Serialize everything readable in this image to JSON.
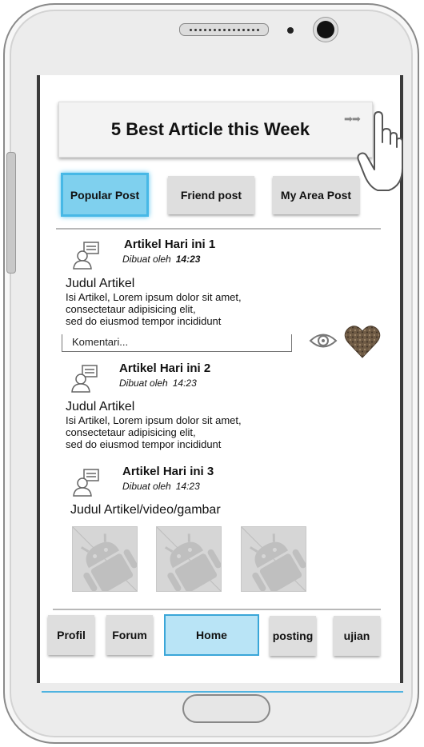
{
  "banner": {
    "title": "5 Best Article this Week",
    "arrow_icons": "➡➡"
  },
  "tabs": [
    {
      "label": "Popular Post",
      "active": true
    },
    {
      "label": "Friend post",
      "active": false
    },
    {
      "label": "My Area Post",
      "active": false
    }
  ],
  "posts": [
    {
      "title": "Artikel Hari ini 1",
      "meta_by": "Dibuat oleh",
      "meta_time": "14:23",
      "heading": "Judul Artikel",
      "body": [
        "Isi Artikel, Lorem ipsum dolor sit amet,",
        "consectetaur adipisicing elit,",
        "sed do eiusmod tempor incididunt"
      ],
      "comment_placeholder": "Komentari..."
    },
    {
      "title": "Artikel Hari ini 2",
      "meta_by": "Dibuat oleh",
      "meta_time": "14:23",
      "heading": "Judul Artikel",
      "body": [
        "Isi Artikel, Lorem ipsum dolor sit amet,",
        "consectetaur adipisicing elit,",
        "sed do eiusmod tempor incididunt"
      ]
    },
    {
      "title": "Artikel Hari ini 3",
      "meta_by": "Dibuat oleh",
      "meta_time": "14:23",
      "heading": "Judul Artikel/video/gambar",
      "media_count": 3
    }
  ],
  "bottom_nav": [
    {
      "label": "Profil",
      "active": false
    },
    {
      "label": "Forum",
      "active": false
    },
    {
      "label": "Home",
      "active": true
    },
    {
      "label": "posting",
      "active": false
    },
    {
      "label": "ujian",
      "active": false
    }
  ],
  "icons": {
    "post_author": "user-post-icon",
    "view": "eye-icon",
    "like": "heart-icon",
    "pointer": "hand-pointer-icon",
    "media": "android-placeholder-icon"
  },
  "colors": {
    "active_tab": "#7fd0ee",
    "active_border": "#47b8e6",
    "home_active": "#b9e4f6",
    "accent_line": "#4fb3e0"
  }
}
